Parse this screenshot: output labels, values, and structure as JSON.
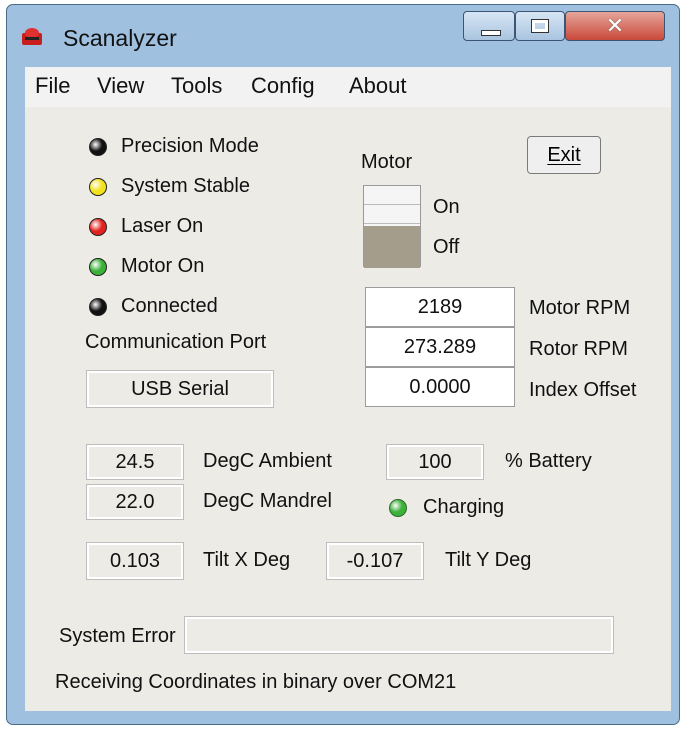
{
  "window": {
    "title": "Scanalyzer"
  },
  "menu": [
    "File",
    "View",
    "Tools",
    "Config",
    "About"
  ],
  "indicators": [
    {
      "label": "Precision Mode",
      "color": "#111111"
    },
    {
      "label": "System Stable",
      "color": "#f2e11d"
    },
    {
      "label": "Laser On",
      "color": "#e3221f"
    },
    {
      "label": "Motor On",
      "color": "#3bb13a"
    },
    {
      "label": "Connected",
      "color": "#111111"
    }
  ],
  "motor": {
    "label": "Motor",
    "on_label": "On",
    "off_label": "Off",
    "state": "Off"
  },
  "exit_label": "Exit",
  "communication_port": {
    "label": "Communication Port",
    "value": "USB Serial"
  },
  "rpm": [
    {
      "value": "2189",
      "label": "Motor RPM"
    },
    {
      "value": "273.289",
      "label": "Rotor RPM"
    },
    {
      "value": "0.0000",
      "label": "Index Offset"
    }
  ],
  "temperatures": [
    {
      "value": "24.5",
      "label": "DegC Ambient"
    },
    {
      "value": "22.0",
      "label": "DegC Mandrel"
    }
  ],
  "battery": {
    "value": "100",
    "label": "% Battery"
  },
  "charging": {
    "label": "Charging",
    "color": "#3bb13a"
  },
  "tilt": [
    {
      "value": "0.103",
      "label": "Tilt X Deg"
    },
    {
      "value": "-0.107",
      "label": "Tilt Y Deg"
    }
  ],
  "system_error": {
    "label": "System Error",
    "value": ""
  },
  "status": "Receiving Coordinates in binary over COM21"
}
